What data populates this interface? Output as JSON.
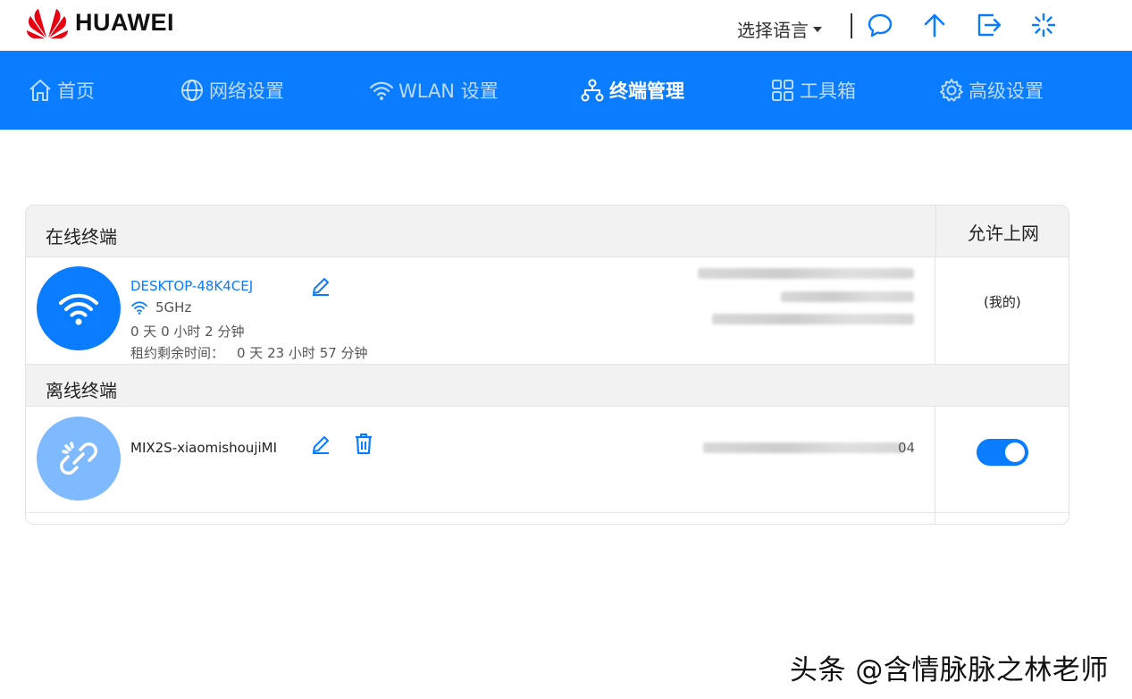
{
  "header": {
    "brand": "HUAWEI",
    "language_label": "选择语言"
  },
  "nav": {
    "items": [
      {
        "label": "首页",
        "icon": "home-icon",
        "active": false
      },
      {
        "label": "网络设置",
        "icon": "globe-icon",
        "active": false
      },
      {
        "label": "WLAN 设置",
        "icon": "wifi-icon",
        "active": false
      },
      {
        "label": "终端管理",
        "icon": "device-tree-icon",
        "active": true
      },
      {
        "label": "工具箱",
        "icon": "grid-icon",
        "active": false
      },
      {
        "label": "高级设置",
        "icon": "gear-icon",
        "active": false
      }
    ]
  },
  "online": {
    "section_title": "在线终端",
    "column_allow": "允许上网",
    "device": {
      "name": "DESKTOP-48K4CEJ",
      "band": "5GHz",
      "uptime": "0 天 0 小时 2 分钟",
      "lease_label": "租约剩余时间：",
      "lease_value": "0 天 23 小时 57 分钟",
      "self_tag": "(我的)"
    }
  },
  "offline": {
    "section_title": "离线终端",
    "device": {
      "name": "MIX2S-xiaomishoujiMI",
      "mac_suffix": "04",
      "internet_allowed": true
    }
  },
  "watermark": "头条 @含情脉脉之林老师",
  "colors": {
    "brand_red": "#e60012",
    "nav_blue": "#0a7cff",
    "online_avatar": "#0a7cff",
    "offline_avatar": "#7fb9ff"
  }
}
